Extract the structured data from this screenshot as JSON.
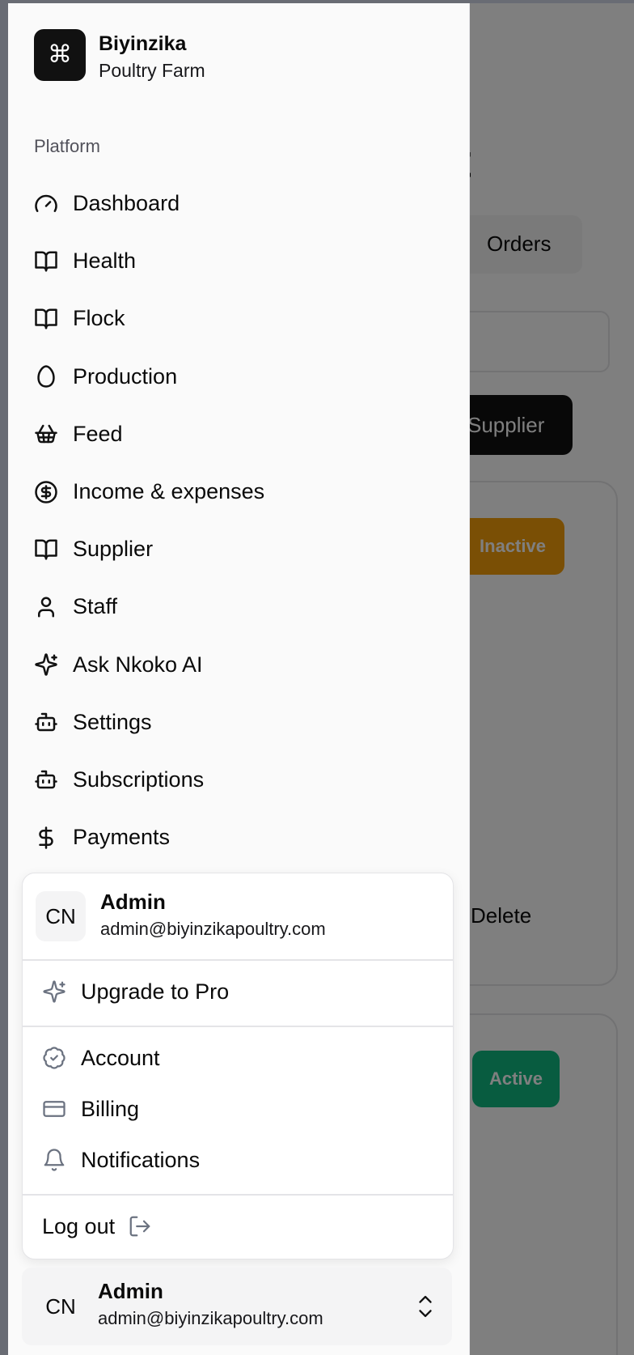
{
  "background": {
    "title_fragment": "nt",
    "tab_label": "Orders",
    "primary_button_label": "Supplier",
    "badge_inactive": "Inactive",
    "badge_active": "Active",
    "delete_label": "Delete"
  },
  "brand": {
    "logo_glyph": "⌘",
    "name": "Biyinzika",
    "subtitle": "Poultry Farm"
  },
  "sidebar": {
    "section_label": "Platform",
    "items": [
      {
        "label": "Dashboard",
        "icon": "gauge-icon"
      },
      {
        "label": "Health",
        "icon": "book-open-icon"
      },
      {
        "label": "Flock",
        "icon": "book-open-icon"
      },
      {
        "label": "Production",
        "icon": "egg-icon"
      },
      {
        "label": "Feed",
        "icon": "shopping-basket-icon"
      },
      {
        "label": "Income & expenses",
        "icon": "circle-dollar-icon"
      },
      {
        "label": "Supplier",
        "icon": "book-open-icon"
      },
      {
        "label": "Staff",
        "icon": "user-icon"
      },
      {
        "label": "Ask Nkoko AI",
        "icon": "sparkles-icon"
      },
      {
        "label": "Settings",
        "icon": "bot-icon"
      },
      {
        "label": "Subscriptions",
        "icon": "bot-icon"
      },
      {
        "label": "Payments",
        "icon": "dollar-sign-icon"
      }
    ]
  },
  "user_menu": {
    "avatar_initials": "CN",
    "name": "Admin",
    "email": "admin@biyinzikapoultry.com",
    "upgrade_label": "Upgrade to Pro",
    "account_label": "Account",
    "billing_label": "Billing",
    "notifications_label": "Notifications",
    "logout_label": "Log out"
  },
  "footer_user": {
    "avatar_initials": "CN",
    "name": "Admin",
    "email": "admin@biyinzikapoultry.com"
  },
  "colors": {
    "inactive_badge": "#f59e0b",
    "active_badge": "#10b981",
    "brand_logo_bg": "#111111"
  }
}
